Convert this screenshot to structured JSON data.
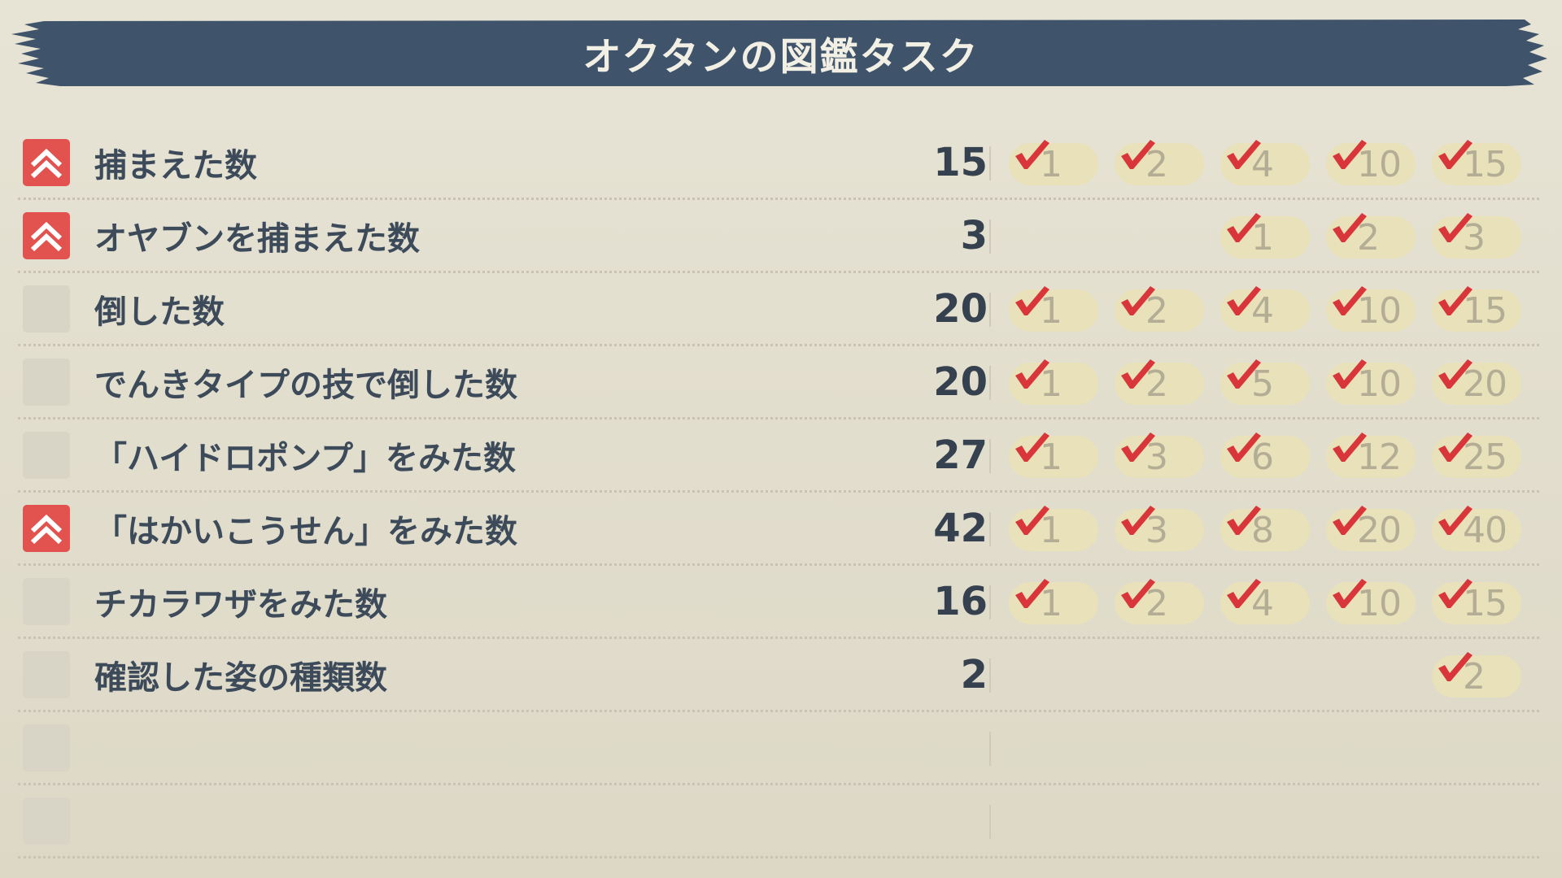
{
  "header": {
    "title": "オクタンの図鑑タスク",
    "banner_color": "#3f536a"
  },
  "colors": {
    "boost_badge": "#e2534f",
    "check": "#d8363a",
    "milestone_pill": "#e9e1b9",
    "milestone_text": "#b4ad96"
  },
  "tasks": [
    {
      "label": "捕まえた数",
      "count": "15",
      "boost": true,
      "milestones": [
        "1",
        "2",
        "4",
        "10",
        "15"
      ],
      "completed": [
        true,
        true,
        true,
        true,
        true
      ]
    },
    {
      "label": "オヤブンを捕まえた数",
      "count": "3",
      "boost": true,
      "milestones": [
        "",
        "",
        "1",
        "2",
        "3"
      ],
      "completed": [
        false,
        false,
        true,
        true,
        true
      ]
    },
    {
      "label": "倒した数",
      "count": "20",
      "boost": false,
      "milestones": [
        "1",
        "2",
        "4",
        "10",
        "15"
      ],
      "completed": [
        true,
        true,
        true,
        true,
        true
      ]
    },
    {
      "label": "でんきタイプの技で倒した数",
      "count": "20",
      "boost": false,
      "milestones": [
        "1",
        "2",
        "5",
        "10",
        "20"
      ],
      "completed": [
        true,
        true,
        true,
        true,
        true
      ]
    },
    {
      "label": "「ハイドロポンプ」をみた数",
      "count": "27",
      "boost": false,
      "milestones": [
        "1",
        "3",
        "6",
        "12",
        "25"
      ],
      "completed": [
        true,
        true,
        true,
        true,
        true
      ]
    },
    {
      "label": "「はかいこうせん」をみた数",
      "count": "42",
      "boost": true,
      "milestones": [
        "1",
        "3",
        "8",
        "20",
        "40"
      ],
      "completed": [
        true,
        true,
        true,
        true,
        true
      ]
    },
    {
      "label": "チカラワザをみた数",
      "count": "16",
      "boost": false,
      "milestones": [
        "1",
        "2",
        "4",
        "10",
        "15"
      ],
      "completed": [
        true,
        true,
        true,
        true,
        true
      ]
    },
    {
      "label": "確認した姿の種類数",
      "count": "2",
      "boost": false,
      "milestones": [
        "",
        "",
        "",
        "",
        "2"
      ],
      "completed": [
        false,
        false,
        false,
        false,
        true
      ]
    },
    {
      "label": "",
      "count": "",
      "boost": false,
      "milestones": [
        "",
        "",
        "",
        "",
        ""
      ],
      "completed": [
        false,
        false,
        false,
        false,
        false
      ]
    },
    {
      "label": "",
      "count": "",
      "boost": false,
      "milestones": [
        "",
        "",
        "",
        "",
        ""
      ],
      "completed": [
        false,
        false,
        false,
        false,
        false
      ]
    }
  ]
}
